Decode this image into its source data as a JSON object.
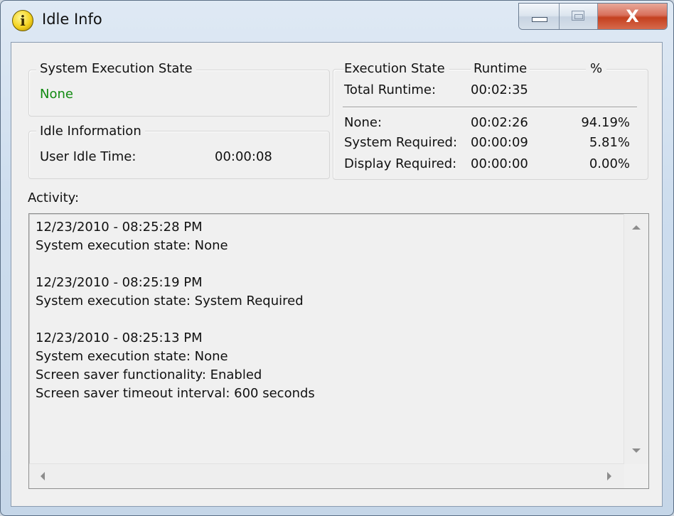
{
  "window": {
    "title": "Idle Info",
    "icon": "info-icon",
    "icon_glyph": "i",
    "controls": {
      "minimize": "minimize-icon",
      "maximize": "maximize-icon",
      "close": "close-icon",
      "close_glyph": "X"
    }
  },
  "system_execution_state": {
    "title": "System Execution State",
    "value": "None",
    "value_color": "#118a11"
  },
  "idle_information": {
    "title": "Idle Information",
    "label": "User Idle Time:",
    "value": "00:00:08"
  },
  "execution_stats": {
    "headers": [
      "Execution State",
      "Runtime",
      "%"
    ],
    "total": {
      "label": "Total Runtime:",
      "runtime": "00:02:35"
    },
    "rows": [
      {
        "state": "None:",
        "runtime": "00:02:26",
        "percent": "94.19%"
      },
      {
        "state": "System Required:",
        "runtime": "00:00:09",
        "percent": "5.81%"
      },
      {
        "state": "Display Required:",
        "runtime": "00:00:00",
        "percent": "0.00%"
      }
    ]
  },
  "activity": {
    "label": "Activity:",
    "log": "12/23/2010 - 08:25:28 PM\nSystem execution state: None\n\n12/23/2010 - 08:25:19 PM\nSystem execution state: System Required\n\n12/23/2010 - 08:25:13 PM\nSystem execution state: None\nScreen saver functionality: Enabled\nScreen saver timeout interval: 600 seconds"
  }
}
